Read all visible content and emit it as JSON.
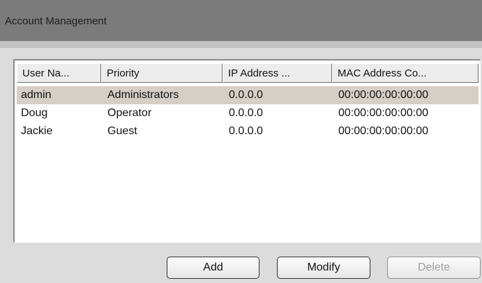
{
  "window": {
    "title": "Account Management"
  },
  "table": {
    "columns": [
      "User Na...",
      "Priority",
      "IP Address ...",
      "MAC Address Co..."
    ],
    "rows": [
      {
        "user": "admin",
        "priority": "Administrators",
        "ip": "0.0.0.0",
        "mac": "00:00:00:00:00:00",
        "selected": true
      },
      {
        "user": "Doug",
        "priority": "Operator",
        "ip": "0.0.0.0",
        "mac": "00:00:00:00:00:00",
        "selected": false
      },
      {
        "user": "Jackie",
        "priority": "Guest",
        "ip": "0.0.0.0",
        "mac": "00:00:00:00:00:00",
        "selected": false
      }
    ]
  },
  "buttons": {
    "add": "Add",
    "modify": "Modify",
    "delete": "Delete"
  },
  "colors": {
    "titlebar": "#7b7b7b",
    "selected_row": "#d5cfc7",
    "disabled_text": "#a0a0a0"
  }
}
